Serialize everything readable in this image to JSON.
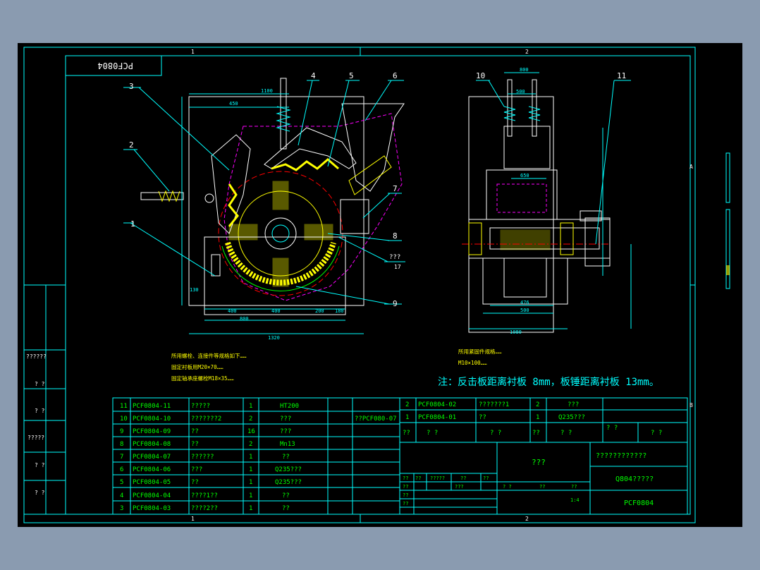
{
  "drawing": {
    "code_box": "PCF0804",
    "zone_numbers": [
      "1",
      "2"
    ],
    "zone_letters": [
      "A",
      "B"
    ],
    "notes_left": [
      "所用螺栓、连接件等规格如下……",
      "固定衬板用M20×70……",
      "固定轴承座螺栓M18×35……"
    ],
    "notes_right": [
      "所用紧固件规格……",
      "M10×100……"
    ],
    "note_main": "注：反击板距离衬板 8mm，板锤距离衬板 13mm。",
    "balloons_front": [
      "1",
      "2",
      "3",
      "4",
      "5",
      "6",
      "7",
      "8",
      "9",
      "???",
      "17"
    ],
    "balloons_side": [
      "10",
      "11"
    ],
    "dims_front": [
      "1320",
      "450",
      "1100",
      "400",
      "400",
      "200",
      "180",
      "800",
      "130"
    ],
    "dims_side": [
      "800",
      "500",
      "1080",
      "500",
      "476",
      "650"
    ]
  },
  "sidebar": {
    "cells": [
      "??????",
      "?  ?",
      "?  ?",
      "?????",
      "?  ?",
      "?  ?"
    ]
  },
  "bom": {
    "rows": [
      {
        "no": "11",
        "code": "PCF0804-11",
        "name": "?????",
        "qty": "1",
        "mat": "HT200",
        "note": ""
      },
      {
        "no": "10",
        "code": "PCF0804-10",
        "name": "???????2",
        "qty": "2",
        "mat": "???",
        "note": "??PCF080-07"
      },
      {
        "no": "9",
        "code": "PCF0804-09",
        "name": "??",
        "qty": "16",
        "mat": "???",
        "note": ""
      },
      {
        "no": "8",
        "code": "PCF0804-08",
        "name": "??",
        "qty": "2",
        "mat": "Mn13",
        "note": ""
      },
      {
        "no": "7",
        "code": "PCF0804-07",
        "name": "??????",
        "qty": "1",
        "mat": "??",
        "note": ""
      },
      {
        "no": "6",
        "code": "PCF0804-06",
        "name": "???",
        "qty": "1",
        "mat": "Q235???",
        "note": ""
      },
      {
        "no": "5",
        "code": "PCF0804-05",
        "name": "??",
        "qty": "1",
        "mat": "Q235???",
        "note": ""
      },
      {
        "no": "4",
        "code": "PCF0804-04",
        "name": "????1??",
        "qty": "1",
        "mat": "??",
        "note": ""
      },
      {
        "no": "3",
        "code": "PCF0804-03",
        "name": "????2??",
        "qty": "1",
        "mat": "??",
        "note": ""
      }
    ],
    "top_rows": [
      {
        "no": "2",
        "code": "PCF0804-02",
        "name": "???????1",
        "qty": "2",
        "mat": "???"
      },
      {
        "no": "1",
        "code": "PCF0804-01",
        "name": "??",
        "qty": "1",
        "mat": "Q235???"
      }
    ],
    "header": [
      "??",
      "?  ?",
      "?  ?",
      "??",
      "?  ?",
      "? ?",
      "?  ?"
    ]
  },
  "title_block": {
    "design": "???",
    "company": "????????????",
    "name": "Q804?????",
    "drawing_no": "PCF0804",
    "scale": "1:4",
    "r1": [
      "??",
      "??",
      "?????",
      "??",
      "??",
      "??"
    ],
    "r2": [
      "??",
      "???"
    ],
    "r3": [
      "??",
      "?  ?",
      "??",
      "??"
    ]
  }
}
